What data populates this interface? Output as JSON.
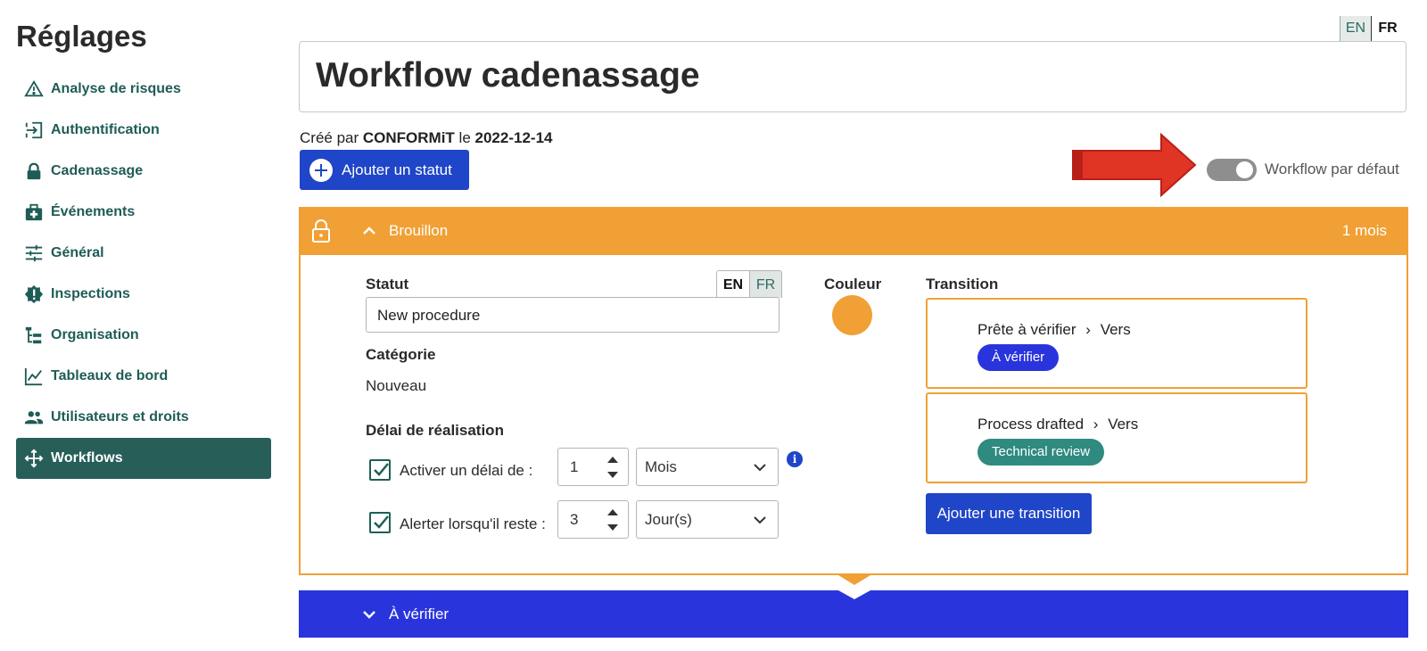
{
  "sidebar": {
    "title": "Réglages",
    "items": [
      {
        "label": "Analyse de risques",
        "icon": "warning-triangle-icon"
      },
      {
        "label": "Authentification",
        "icon": "login-icon"
      },
      {
        "label": "Cadenassage",
        "icon": "lock-icon"
      },
      {
        "label": "Événements",
        "icon": "first-aid-kit-icon"
      },
      {
        "label": "Général",
        "icon": "sliders-icon"
      },
      {
        "label": "Inspections",
        "icon": "badge-alert-icon"
      },
      {
        "label": "Organisation",
        "icon": "org-tree-icon"
      },
      {
        "label": "Tableaux de bord",
        "icon": "line-chart-icon"
      },
      {
        "label": "Utilisateurs et droits",
        "icon": "users-icon"
      },
      {
        "label": "Workflows",
        "icon": "workflow-icon",
        "active": true
      }
    ]
  },
  "lang_switch": {
    "en": "EN",
    "fr": "FR",
    "selected": "FR"
  },
  "workflow": {
    "title": "Workflow cadenassage",
    "created_prefix": "Créé par",
    "created_by": "CONFORMiT",
    "created_mid": "le",
    "created_date": "2022-12-14",
    "add_status_label": "Ajouter un statut",
    "default_toggle_label": "Workflow par défaut",
    "default_toggle_on": true
  },
  "status_open": {
    "name": "Brouillon",
    "duration": "1 mois",
    "color": "#f0a035",
    "statut_label": "Statut",
    "lang_en": "EN",
    "lang_fr": "FR",
    "statut_value": "New procedure",
    "couleur_label": "Couleur",
    "categorie_label": "Catégorie",
    "categorie_value": "Nouveau",
    "delai_label": "Délai de réalisation",
    "delai_checkbox_label": "Activer un délai de :",
    "delai_value": "1",
    "delai_unit": "Mois",
    "alert_checkbox_label": "Alerter lorsqu'il reste :",
    "alert_value": "3",
    "alert_unit": "Jour(s)",
    "transition_label": "Transition",
    "transitions": [
      {
        "name": "Prête à vérifier",
        "sep": "›",
        "vers": "Vers",
        "target": "À vérifier",
        "target_color": "#2a34dd"
      },
      {
        "name": "Process drafted",
        "sep": "›",
        "vers": "Vers",
        "target": "Technical review",
        "target_color": "#2f8a80"
      }
    ],
    "add_transition_label": "Ajouter une transition"
  },
  "status_next": {
    "name": "À vérifier",
    "color": "#2a34dd"
  }
}
